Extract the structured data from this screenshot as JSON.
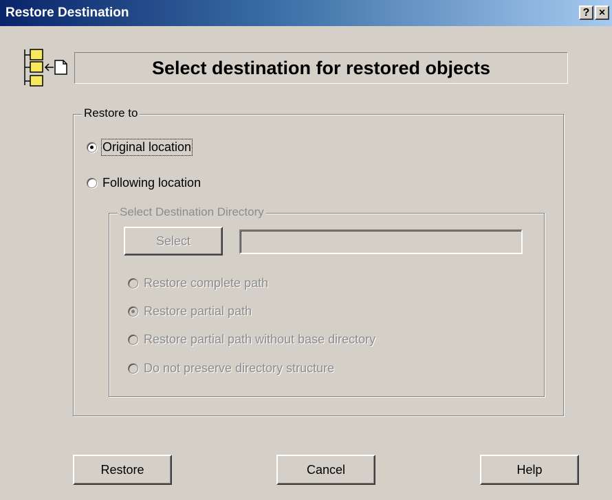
{
  "window": {
    "title": "Restore Destination",
    "help_glyph": "?",
    "close_glyph": "×"
  },
  "header": {
    "icon": "folder-tree-restore-icon",
    "title": "Select destination for restored objects"
  },
  "restore_to": {
    "legend": "Restore to",
    "options": [
      {
        "label": "Original location",
        "checked": true,
        "focused": true
      },
      {
        "label": "Following location",
        "checked": false
      }
    ]
  },
  "destination": {
    "legend": "Select Destination Directory",
    "enabled": false,
    "select_label": "Select",
    "path_value": "",
    "path_options": [
      {
        "label": "Restore complete path",
        "checked": false
      },
      {
        "label": "Restore partial path",
        "checked": true
      },
      {
        "label": "Restore partial path without base directory",
        "checked": false
      },
      {
        "label": "Do not preserve directory structure",
        "checked": false
      }
    ]
  },
  "footer": {
    "restore_label": "Restore",
    "cancel_label": "Cancel",
    "help_label": "Help"
  },
  "colors": {
    "dialog_bg": "#d4d0c8",
    "titlebar_start": "#0a246a",
    "titlebar_end": "#a6caf0",
    "folder_yellow": "#f8e860",
    "disabled_text": "#8c8c8c"
  }
}
